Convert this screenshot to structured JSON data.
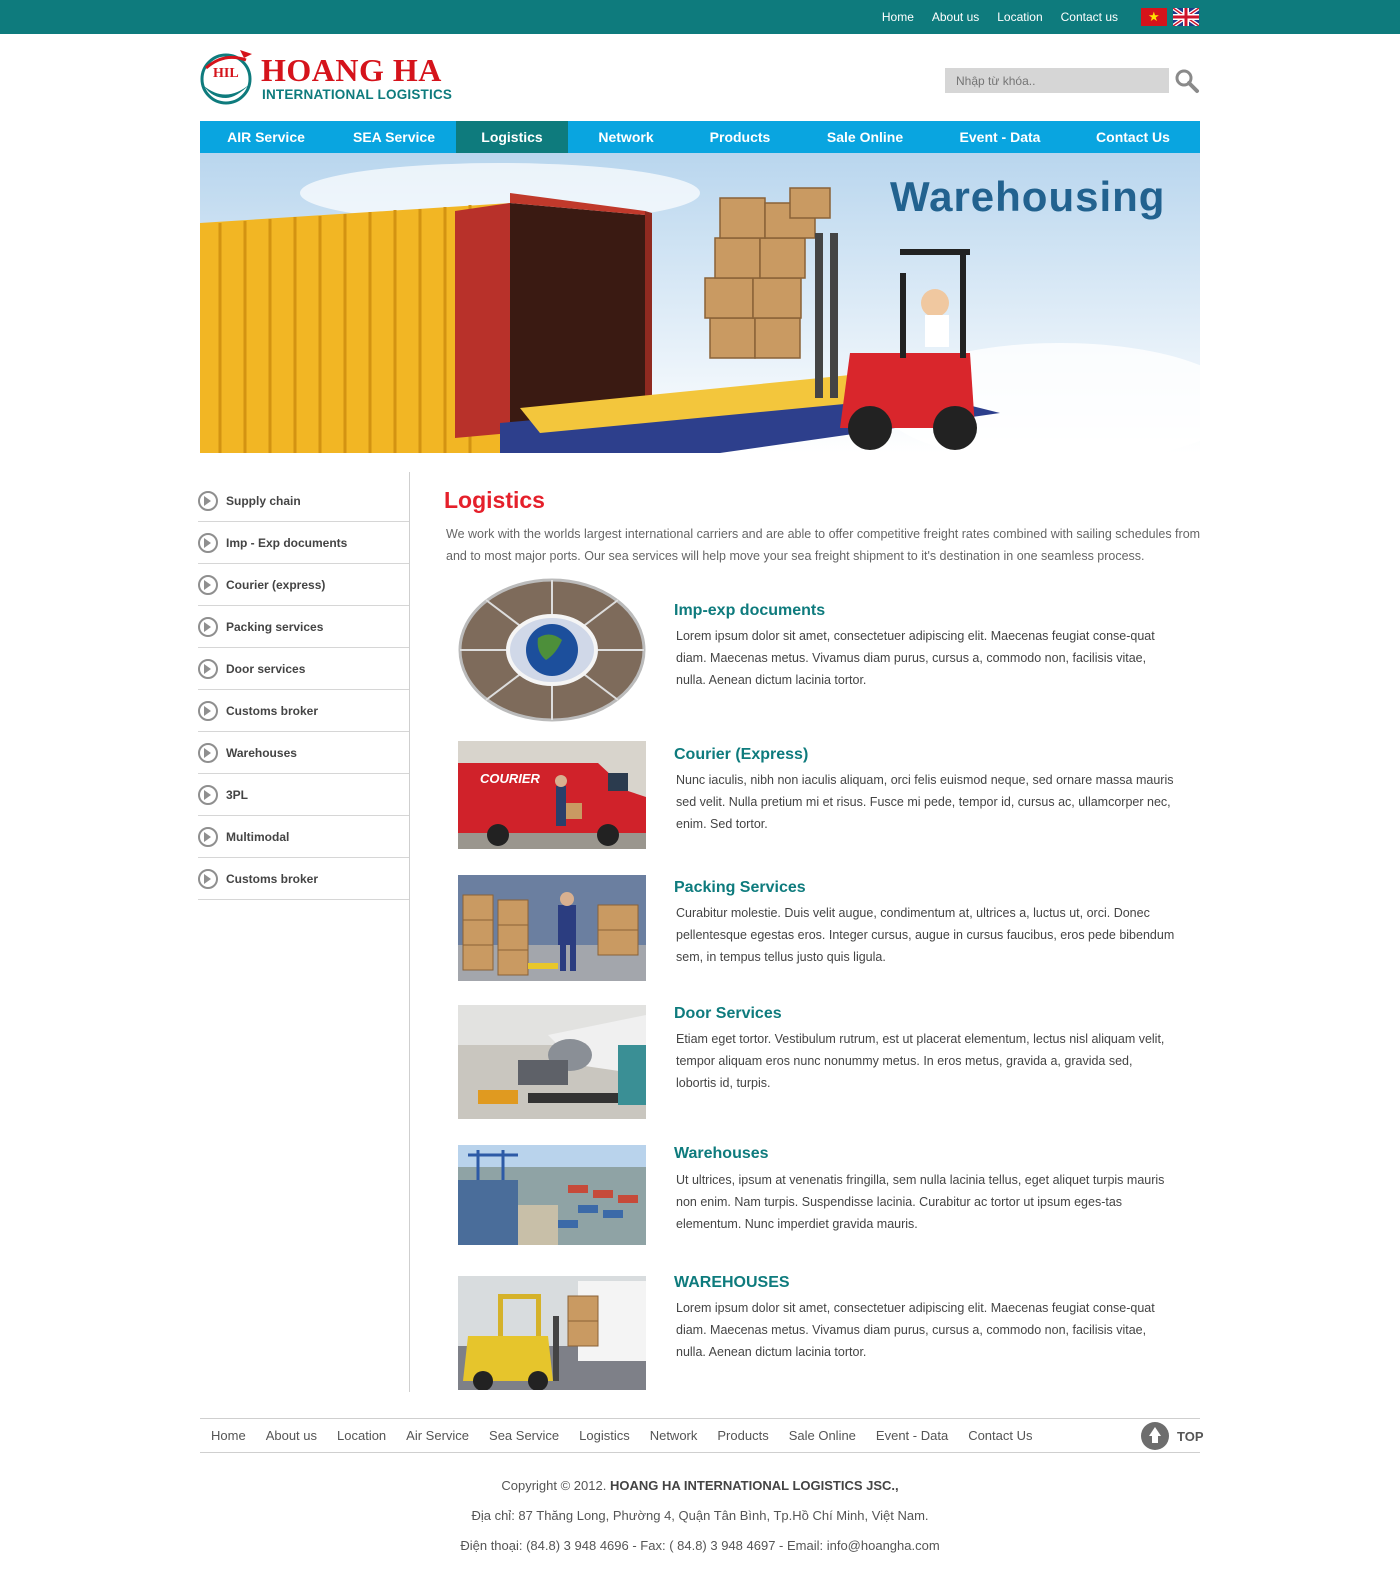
{
  "topbar": {
    "links": [
      "Home",
      "About us",
      "Location",
      "Contact us"
    ]
  },
  "brand": {
    "name": "HOANG HA",
    "subtitle": "INTERNATIONAL LOGISTICS",
    "mark": "HIL"
  },
  "search": {
    "placeholder": "Nhập từ khóa.."
  },
  "nav": {
    "items": [
      "AIR Service",
      "SEA Service",
      "Logistics",
      "Network",
      "Products",
      "Sale Online",
      "Event - Data",
      "Contact Us"
    ],
    "active": "Logistics"
  },
  "banner": {
    "title": "Warehousing"
  },
  "sidebar": {
    "items": [
      "Supply chain",
      "Imp - Exp documents",
      "Courier (express)",
      "Packing services",
      "Door services",
      "Customs broker",
      "Warehouses",
      "3PL",
      "Multimodal",
      "Customs broker"
    ]
  },
  "main": {
    "title": "Logistics",
    "intro": "We work with the worlds largest international carriers and are able to offer competitive freight rates combined with sailing schedules from and to most major ports. Our sea services will help move your sea freight shipment to it's destination in one seamless process.",
    "services": [
      {
        "title": "Imp-exp documents",
        "text": "Lorem ipsum dolor sit amet, consectetuer adipiscing elit. Maecenas feugiat conse-quat diam. Maecenas metus. Vivamus diam purus, cursus a, commodo non, facilisis vitae, nulla. Aenean dictum lacinia tortor."
      },
      {
        "title": "Courier (Express)",
        "text": "Nunc iaculis, nibh non iaculis aliquam, orci felis euismod neque, sed ornare massa mauris sed velit. Nulla pretium mi et risus. Fusce mi pede, tempor id, cursus ac, ullamcorper nec, enim. Sed tortor."
      },
      {
        "title": "Packing Services",
        "text": "Curabitur molestie. Duis velit augue, condimentum at, ultrices a, luctus ut, orci. Donec pellentesque egestas eros. Integer cursus, augue in cursus faucibus, eros pede bibendum sem, in tempus tellus justo quis ligula."
      },
      {
        "title": "Door Services",
        "text": "Etiam eget tortor. Vestibulum rutrum, est ut placerat elementum, lectus nisl aliquam velit, tempor aliquam eros nunc nonummy metus. In eros metus, gravida a, gravida sed, lobortis id, turpis."
      },
      {
        "title": "Warehouses",
        "text": "Ut ultrices, ipsum at venenatis fringilla, sem nulla lacinia tellus, eget aliquet turpis mauris non enim. Nam turpis. Suspendisse lacinia. Curabitur ac tortor ut ipsum eges-tas elementum. Nunc imperdiet gravida mauris."
      },
      {
        "title": "WAREHOUSES",
        "text": "Lorem ipsum dolor sit amet, consectetuer adipiscing elit. Maecenas feugiat conse-quat diam. Maecenas metus. Vivamus diam purus, cursus a, commodo non, facilisis vitae, nulla. Aenean dictum lacinia tortor."
      }
    ],
    "courier_van_text": "COURIER"
  },
  "footer": {
    "links": [
      "Home",
      "About us",
      "Location",
      "Air Service",
      "Sea Service",
      "Logistics",
      "Network",
      "Products",
      "Sale Online",
      "Event - Data",
      "Contact Us"
    ],
    "top_label": "TOP",
    "copyright_prefix": "Copyright © 2012.",
    "company": "HOANG HA INTERNATIONAL LOGISTICS JSC.,",
    "address": "Địa chỉ: 87 Thăng Long, Phường 4, Quận Tân Bình, Tp.Hồ Chí Minh, Việt Nam.",
    "contact": "Điện thoại: (84.8) 3 948 4696 - Fax: ( 84.8) 3 948 4697 - Email: info@hoangha.com"
  },
  "colors": {
    "teal": "#0e7b7d",
    "nav_blue": "#09a5e0",
    "red": "#e5202b",
    "banner_title": "#22628f"
  }
}
